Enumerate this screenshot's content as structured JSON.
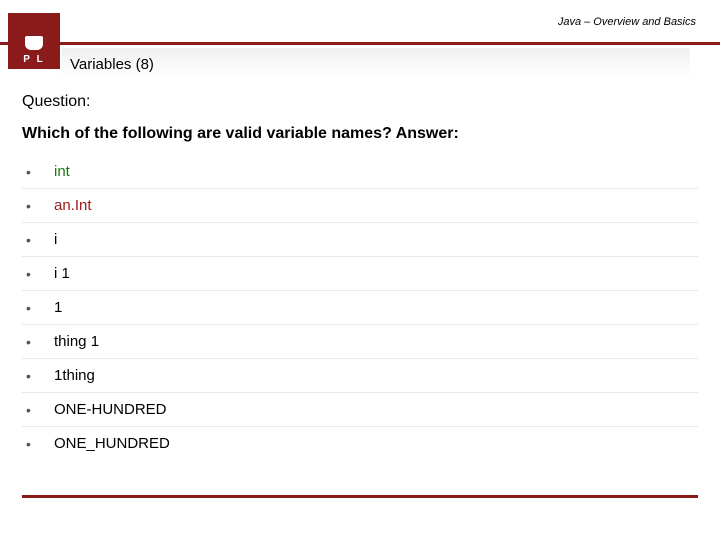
{
  "header": {
    "course_label": "Java – Overview and Basics",
    "logo_letters": "P   L"
  },
  "title": "Variables (8)",
  "question_label": "Question:",
  "question_text": "Which of the following are valid variable names? Answer:",
  "items": [
    {
      "text": "int",
      "cls": "green"
    },
    {
      "text": "an.Int",
      "cls": "red"
    },
    {
      "text": "i",
      "cls": ""
    },
    {
      "text": "i 1",
      "cls": ""
    },
    {
      "text": "1",
      "cls": ""
    },
    {
      "text": "thing 1",
      "cls": ""
    },
    {
      "text": "1thing",
      "cls": ""
    },
    {
      "text": "ONE-HUNDRED",
      "cls": ""
    },
    {
      "text": "ONE_HUNDRED",
      "cls": ""
    }
  ]
}
